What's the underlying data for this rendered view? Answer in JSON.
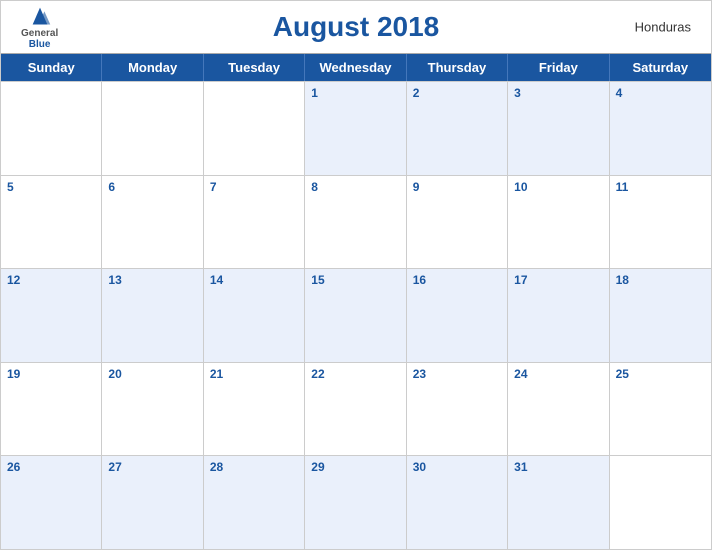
{
  "header": {
    "title": "August 2018",
    "country": "Honduras",
    "logo": {
      "general": "General",
      "blue": "Blue"
    }
  },
  "dayHeaders": [
    "Sunday",
    "Monday",
    "Tuesday",
    "Wednesday",
    "Thursday",
    "Friday",
    "Saturday"
  ],
  "weeks": [
    [
      {
        "day": "",
        "empty": true
      },
      {
        "day": "",
        "empty": true
      },
      {
        "day": "",
        "empty": true
      },
      {
        "day": "1",
        "empty": false
      },
      {
        "day": "2",
        "empty": false
      },
      {
        "day": "3",
        "empty": false
      },
      {
        "day": "4",
        "empty": false
      }
    ],
    [
      {
        "day": "5",
        "empty": false
      },
      {
        "day": "6",
        "empty": false
      },
      {
        "day": "7",
        "empty": false
      },
      {
        "day": "8",
        "empty": false
      },
      {
        "day": "9",
        "empty": false
      },
      {
        "day": "10",
        "empty": false
      },
      {
        "day": "11",
        "empty": false
      }
    ],
    [
      {
        "day": "12",
        "empty": false
      },
      {
        "day": "13",
        "empty": false
      },
      {
        "day": "14",
        "empty": false
      },
      {
        "day": "15",
        "empty": false
      },
      {
        "day": "16",
        "empty": false
      },
      {
        "day": "17",
        "empty": false
      },
      {
        "day": "18",
        "empty": false
      }
    ],
    [
      {
        "day": "19",
        "empty": false
      },
      {
        "day": "20",
        "empty": false
      },
      {
        "day": "21",
        "empty": false
      },
      {
        "day": "22",
        "empty": false
      },
      {
        "day": "23",
        "empty": false
      },
      {
        "day": "24",
        "empty": false
      },
      {
        "day": "25",
        "empty": false
      }
    ],
    [
      {
        "day": "26",
        "empty": false
      },
      {
        "day": "27",
        "empty": false
      },
      {
        "day": "28",
        "empty": false
      },
      {
        "day": "29",
        "empty": false
      },
      {
        "day": "30",
        "empty": false
      },
      {
        "day": "31",
        "empty": false
      },
      {
        "day": "",
        "empty": true
      }
    ]
  ],
  "colors": {
    "blue": "#1a56a0",
    "lightBlue": "#dce8f8",
    "headerBg": "#1a56a0"
  }
}
